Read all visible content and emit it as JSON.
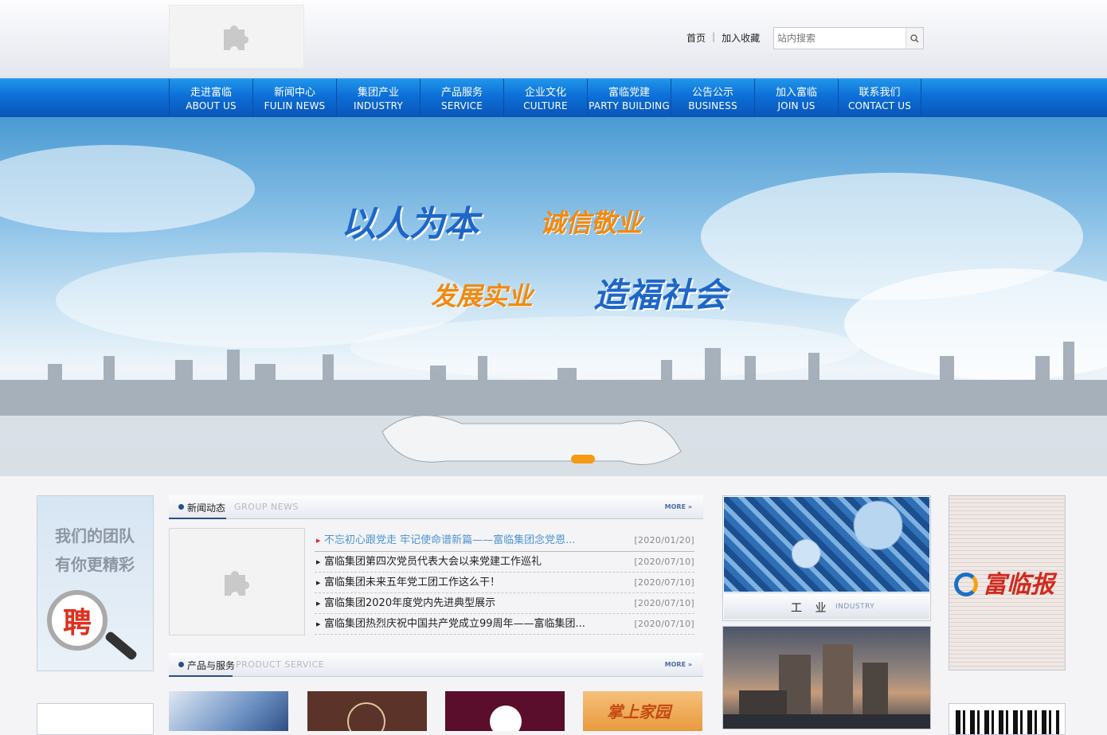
{
  "header": {
    "logo_icon": "puzzle-placeholder-icon",
    "links": [
      {
        "label": "首页"
      },
      {
        "label": "加入收藏"
      }
    ],
    "link_separator": "|",
    "search": {
      "placeholder": "站内搜索",
      "button_icon": "search-icon"
    }
  },
  "nav": {
    "items": [
      {
        "cn": "走进富临",
        "en": "ABOUT US"
      },
      {
        "cn": "新闻中心",
        "en": "FULIN NEWS"
      },
      {
        "cn": "集团产业",
        "en": "INDUSTRY"
      },
      {
        "cn": "产品服务",
        "en": "SERVICE"
      },
      {
        "cn": "企业文化",
        "en": "CULTURE"
      },
      {
        "cn": "富临党建",
        "en": "PARTY BUILDING"
      },
      {
        "cn": "公告公示",
        "en": "BUSINESS"
      },
      {
        "cn": "加入富临",
        "en": "JOIN US"
      },
      {
        "cn": "联系我们",
        "en": "CONTACT US"
      }
    ]
  },
  "banner": {
    "slogans": [
      "以人为本",
      "诚信敬业",
      "发展实业",
      "造福社会"
    ],
    "colors": {
      "blue": "#1e66c8",
      "orange": "#f08a10"
    },
    "active_slide": 1,
    "slide_count": 1
  },
  "recruit": {
    "line1": "我们的团队",
    "line2": "有你更精彩",
    "badge": "聘"
  },
  "news": {
    "title": "新闻动态",
    "en_title": "GROUP NEWS",
    "more": "MORE",
    "image_icon": "puzzle-placeholder-icon",
    "items": [
      {
        "title": "不忘初心跟党走 牢记使命谱新篇——富临集团念党恩...",
        "date": "[2020/01/20]"
      },
      {
        "title": "富临集团第四次党员代表大会以来党建工作巡礼",
        "date": "[2020/07/10]"
      },
      {
        "title": "富临集团未来五年党工团工作这么干！",
        "date": "[2020/07/10]"
      },
      {
        "title": "富临集团2020年度党内先进典型展示",
        "date": "[2020/07/10]"
      },
      {
        "title": "富临集团热烈庆祝中国共产党成立99周年——富临集团...",
        "date": "[2020/07/10]"
      }
    ]
  },
  "products": {
    "title": "产品与服务",
    "en_title": "PRODUCT SERVICE",
    "more": "MORE",
    "items": [
      {
        "name": "product-1",
        "label": ""
      },
      {
        "name": "product-2",
        "label": ""
      },
      {
        "name": "product-3",
        "label": ""
      },
      {
        "name": "product-4",
        "label": "掌上家园"
      }
    ]
  },
  "industry": {
    "cn": "工 业",
    "en": "INDUSTRY"
  },
  "newspaper": {
    "masthead": "富临报"
  }
}
